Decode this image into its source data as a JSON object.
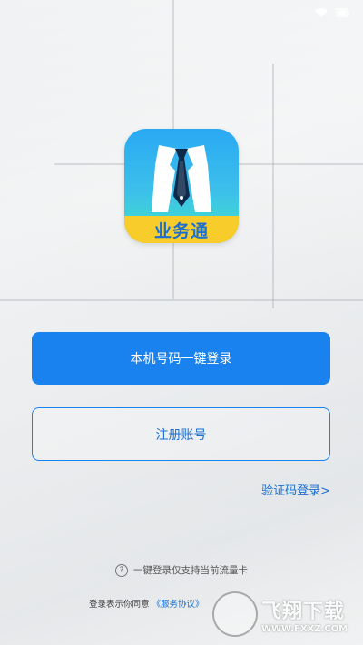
{
  "status_bar": {
    "wifi_icon": "wifi-icon",
    "battery_text": "",
    "time": ""
  },
  "logo": {
    "icon": "suit-tie-icon",
    "text": "业务通",
    "colors": {
      "top": "#2aa9f3",
      "band": "#f7cc2b",
      "text": "#1a6fd0"
    }
  },
  "actions": {
    "one_click_login": "本机号码一键登录",
    "register": "注册账号",
    "sms_login": "验证码登录>"
  },
  "footer": {
    "tip": "一键登录仅支持当前流量卡",
    "agreement_prefix": "登录表示你同意",
    "agreement_link": "《服务协议》"
  },
  "watermark": {
    "title": "飞翔下载",
    "url": "WWW.FXXZ.COM"
  },
  "colors": {
    "accent": "#1a82ee",
    "link": "#1a6fd0"
  }
}
